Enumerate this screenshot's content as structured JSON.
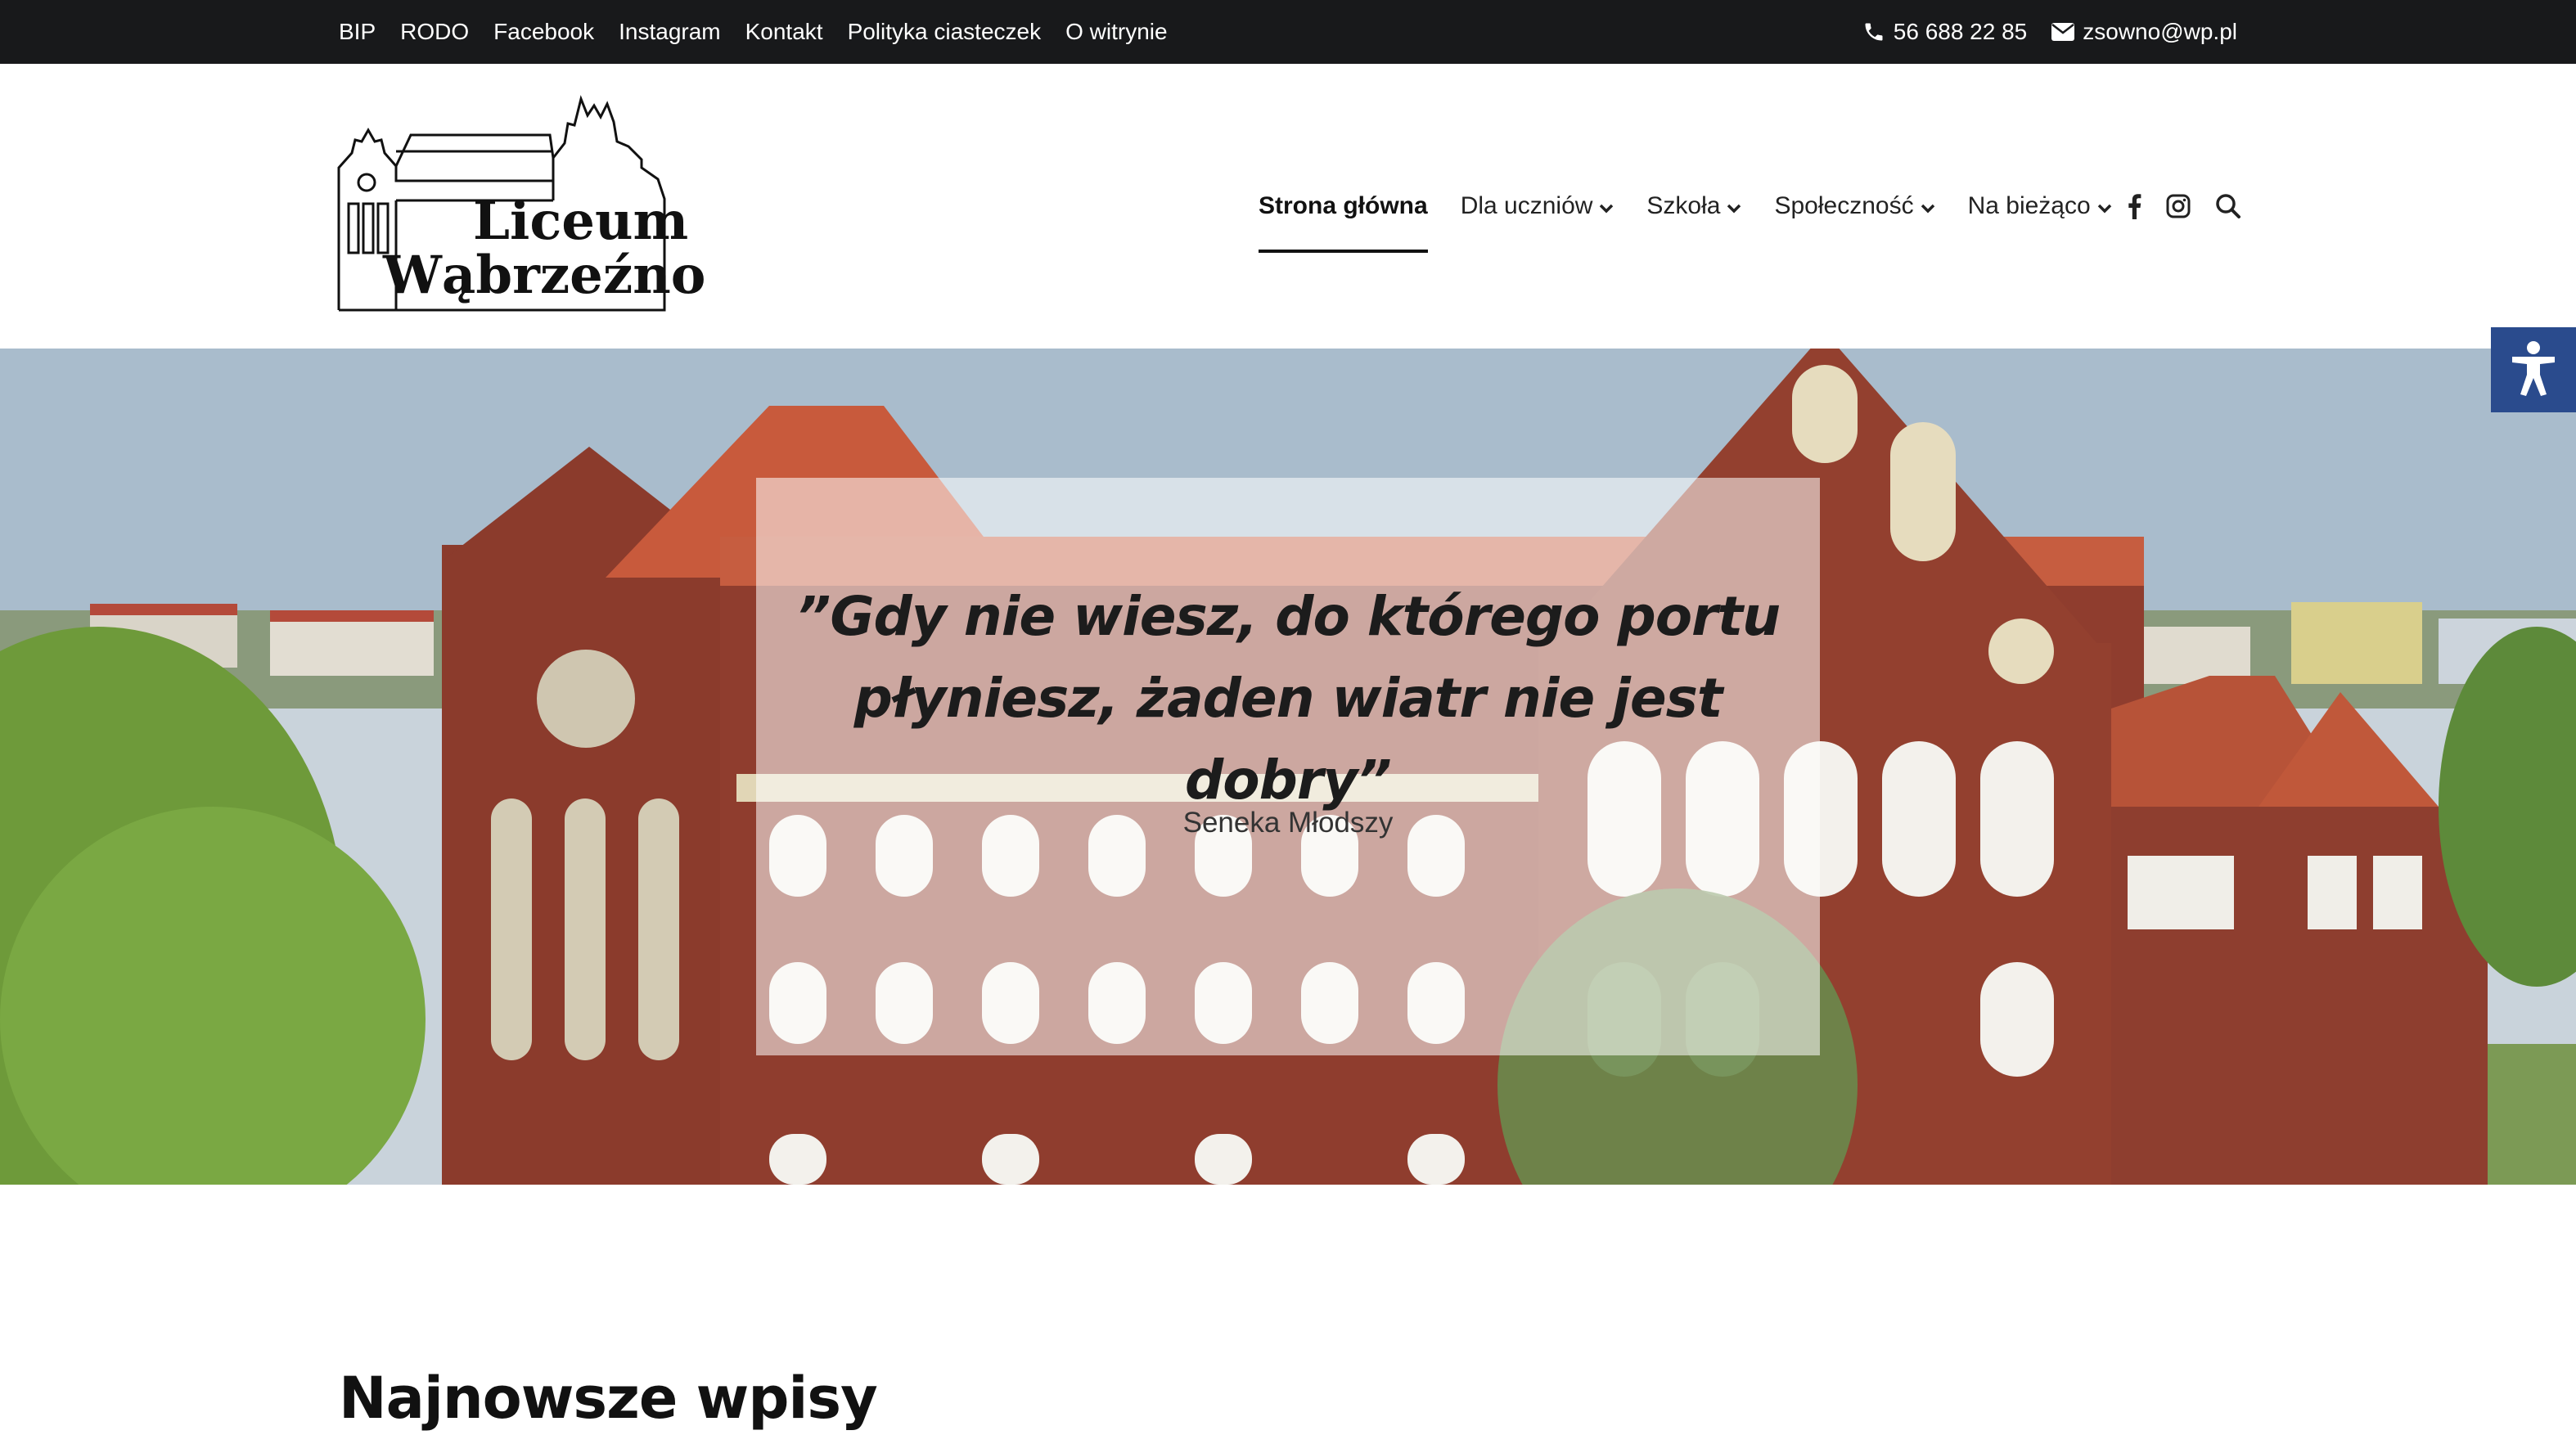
{
  "topbar": {
    "links": [
      "BIP",
      "RODO",
      "Facebook",
      "Instagram",
      "Kontakt",
      "Polityka ciasteczek",
      "O witrynie"
    ],
    "phone": "56 688 22 85",
    "email": "zsowno@wp.pl",
    "phone_icon": "phone-icon",
    "email_icon": "envelope-icon"
  },
  "logo": {
    "line1": "Liceum",
    "line2": "Wąbrzeźno"
  },
  "nav": {
    "items": [
      {
        "label": "Strona główna",
        "active": true,
        "has_dropdown": false
      },
      {
        "label": "Dla uczniów",
        "has_dropdown": true
      },
      {
        "label": "Szkoła",
        "has_dropdown": true
      },
      {
        "label": "Społeczność",
        "has_dropdown": true
      },
      {
        "label": "Na bieżąco",
        "has_dropdown": true
      }
    ],
    "icons": [
      "facebook-icon",
      "instagram-icon",
      "search-icon"
    ]
  },
  "hero": {
    "quote_line1": "”Gdy nie wiesz, do którego portu",
    "quote_line2": "płyniesz, żaden wiatr nie jest dobry”",
    "author": "Seneka Młodszy"
  },
  "accessibility": {
    "icon": "accessibility-icon"
  },
  "section": {
    "title": "Najnowsze wpisy"
  },
  "colors": {
    "topbar_bg": "#18191b",
    "a11y_bg": "#2a4b8d",
    "brick": "#8a3a2c",
    "roof": "#c4573a"
  }
}
